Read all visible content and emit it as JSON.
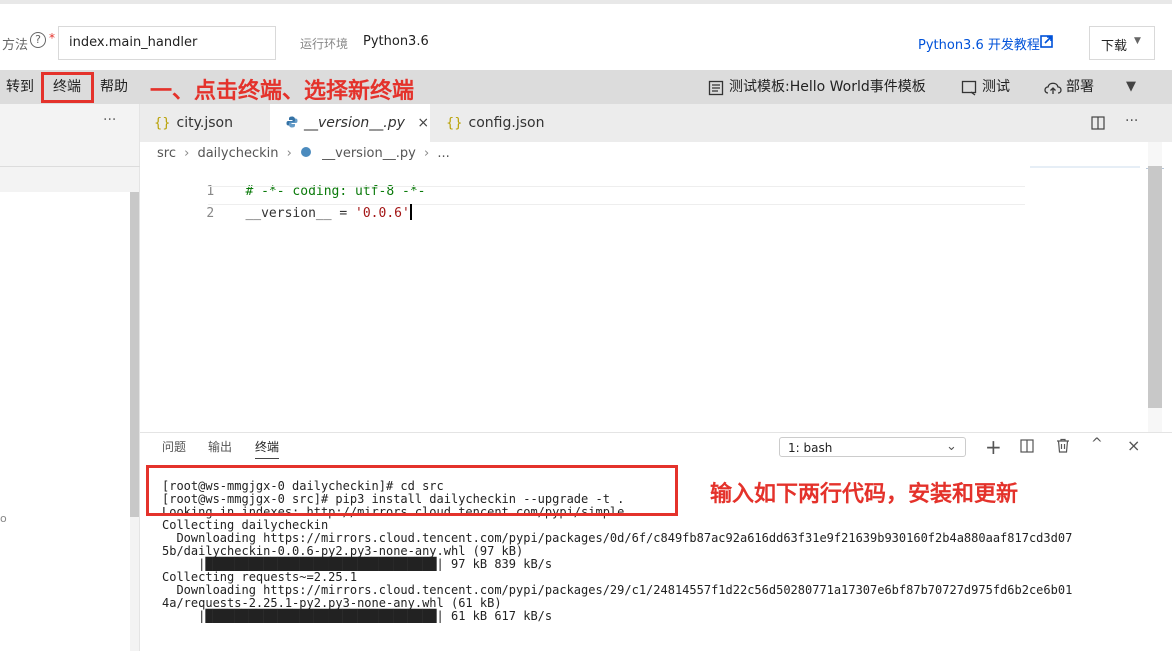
{
  "form": {
    "method_label": "方法",
    "handler_value": "index.main_handler",
    "runtime_label": "运行环境",
    "runtime_value": "Python3.6",
    "tutorial_link": "Python3.6 开发教程",
    "download_label": "下载"
  },
  "menu": {
    "goto": "转到",
    "terminal": "终端",
    "help": "帮助",
    "annotation": "一、点击终端、选择新终端",
    "test_template": "测试模板:Hello World事件模板",
    "test": "测试",
    "deploy": "部署"
  },
  "sidebar": {
    "ellipsis": "···"
  },
  "tabs": [
    {
      "label": "city.json",
      "icon": "braces-icon"
    },
    {
      "label": "__version__.py",
      "icon": "python-file-icon",
      "active": true
    },
    {
      "label": "config.json",
      "icon": "braces-icon"
    }
  ],
  "editor": {
    "breadcrumb": {
      "src": "src",
      "pkg": "dailycheckin",
      "file": "__version__.py",
      "more": "..."
    },
    "lines": [
      {
        "num": "1",
        "text": "# -*- coding: utf-8 -*-"
      },
      {
        "num": "2",
        "pre": "__version__ = ",
        "str": "'0.0.6'"
      }
    ]
  },
  "panel": {
    "tabs": [
      "问题",
      "输出",
      "终端"
    ],
    "active_tab": "终端",
    "shell_select": "1: bash",
    "annotation": "输入如下两行代码，安装和更新",
    "terminal_lines": [
      "[root@ws-mmgjgx-0 dailycheckin]# cd src",
      "[root@ws-mmgjgx-0 src]# pip3 install dailycheckin --upgrade -t .",
      "Looking in indexes: http://mirrors.cloud.tencent.com/pypi/simple",
      "Collecting dailycheckin",
      "  Downloading https://mirrors.cloud.tencent.com/pypi/packages/0d/6f/c849fb87ac92a616dd63f31e9f21639b930160f2b4a880aaf817cd3d07",
      "5b/dailycheckin-0.0.6-py2.py3-none-any.whl (97 kB)",
      "     |████████████████████████████████| 97 kB 839 kB/s",
      "Collecting requests~=2.25.1",
      "  Downloading https://mirrors.cloud.tencent.com/pypi/packages/29/c1/24814557f1d22c56d50280771a17307e6bf87b70727d975fd6b2ce6b01",
      "4a/requests-2.25.1-py2.py3-none-any.whl (61 kB)",
      "     |████████████████████████████████| 61 kB 617 kB/s"
    ]
  }
}
